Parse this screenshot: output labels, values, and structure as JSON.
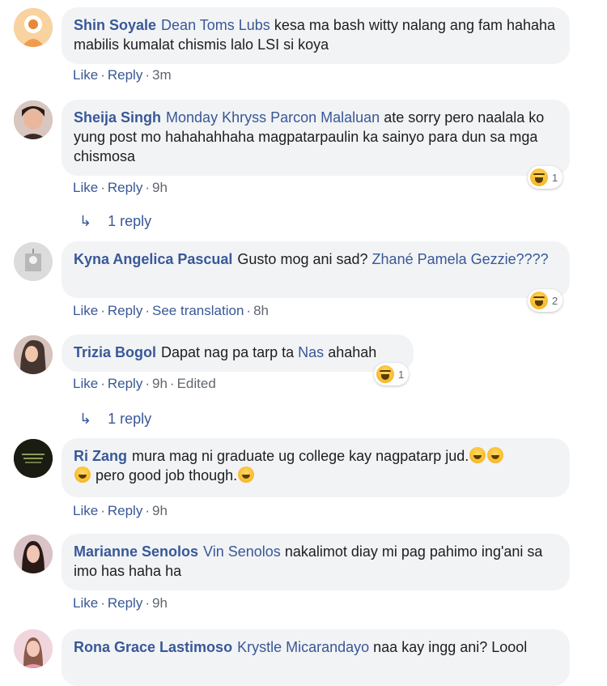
{
  "comments": [
    {
      "name": "Shin Soyale",
      "mention": "Dean Toms Lubs",
      "text": "kesa ma bash witty nalang ang fam hahaha mabilis kumalat chismis lalo LSI si koya",
      "actions": [
        "Like",
        "Reply"
      ],
      "time": "3m"
    },
    {
      "name": "Sheija Singh",
      "mention": "Monday Khryss Parcon Malaluan",
      "text": "ate sorry pero naalala ko yung post mo hahahahhaha magpatarpaulin ka sainyo para dun sa mga chismosa",
      "actions": [
        "Like",
        "Reply"
      ],
      "time": "9h",
      "reaction_count": "1",
      "replies": "1 reply"
    },
    {
      "name": "Kyna Angelica Pascual",
      "text_before": "Gusto mog ani sad?",
      "mention": "Zhané Pamela Gezzie????",
      "actions": [
        "Like",
        "Reply",
        "See translation"
      ],
      "time": "8h",
      "reaction_count": "2"
    },
    {
      "name": "Trizia Bogol",
      "text_before": "Dapat nag pa tarp ta",
      "mention": "Nas",
      "text": "ahahah",
      "actions": [
        "Like",
        "Reply"
      ],
      "time": "9h",
      "edited": "Edited",
      "reaction_count": "1",
      "replies": "1 reply"
    },
    {
      "name": "Ri Zang",
      "text": "mura mag ni graduate ug college kay nagpatarp jud.",
      "text2": "pero good job though.",
      "actions": [
        "Like",
        "Reply"
      ],
      "time": "9h"
    },
    {
      "name": "Marianne Senolos",
      "mention": "Vin Senolos",
      "text": "nakalimot diay mi pag pahimo ing'ani sa imo has haha ha",
      "actions": [
        "Like",
        "Reply"
      ],
      "time": "9h"
    },
    {
      "name": "Rona Grace Lastimoso",
      "mention": "Krystle Micarandayo",
      "text": "naa kay ingg ani? Loool"
    }
  ],
  "icons": {
    "reaction": "haha-reaction-icon",
    "reply_arrow": "reply-arrow-icon"
  },
  "colors": {
    "link": "#385898",
    "bubble": "#f2f3f5",
    "meta": "#606770"
  }
}
